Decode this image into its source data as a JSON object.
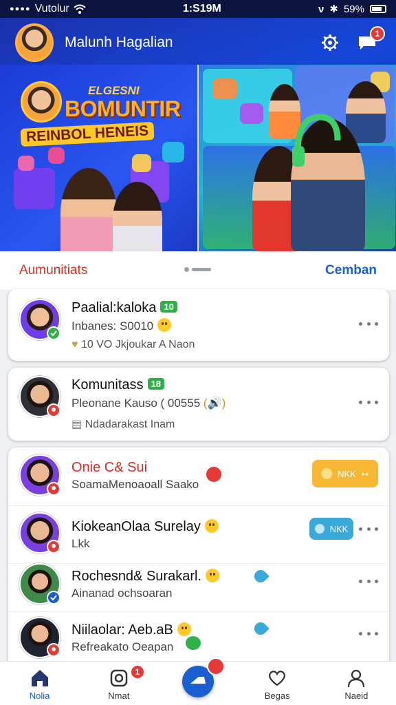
{
  "status_bar": {
    "carrier": "Vutolur",
    "time": "1:S19M",
    "battery": "59%"
  },
  "header": {
    "user_name": "Malunh Hagalian",
    "notification_count": "1"
  },
  "banner": {
    "small_title": "ELGESNI",
    "title": "BOMUNTIR",
    "subtitle": "REINBOL HENEIS"
  },
  "section": {
    "title": "Aumunitiats",
    "link": "Cemban"
  },
  "cards": {
    "first": {
      "title": "Paalial:kaloka",
      "pill": "10",
      "subtitle": "Inbanes: S0010",
      "meta": "10 VO Jkjoukar A Naon"
    },
    "second": {
      "title": "Komunitass",
      "pill": "18",
      "subtitle": "Pleonane Kauso ( 00555",
      "meta": "Ndadarakast  Inam"
    },
    "list": [
      {
        "title": "Onie C& Sui",
        "subtitle": "SoamaMenoaoall Saako",
        "action": "NKK"
      },
      {
        "title": "KiokeanOlaa Surelay",
        "subtitle": "Lkk",
        "action": "NKK"
      },
      {
        "title": "Rochesnd& Surakarl.",
        "subtitle": "Ainanad ochsoaran"
      },
      {
        "title": "Niilaolar: Aeb.aB",
        "subtitle": "Refreakato Oeapan"
      }
    ]
  },
  "bottom_nav": {
    "items": [
      {
        "label": "Nolia"
      },
      {
        "label": "Nmat",
        "badge": "1"
      },
      {
        "label": "",
        "badge": ""
      },
      {
        "label": "Begas"
      },
      {
        "label": "Naeid"
      }
    ]
  },
  "colors": {
    "primary": "#1a5fd0",
    "accent_red": "#d62e1f",
    "pill_green": "#2fb14a",
    "pill_orange": "#f7b733",
    "pill_teal": "#3aa8d8"
  }
}
